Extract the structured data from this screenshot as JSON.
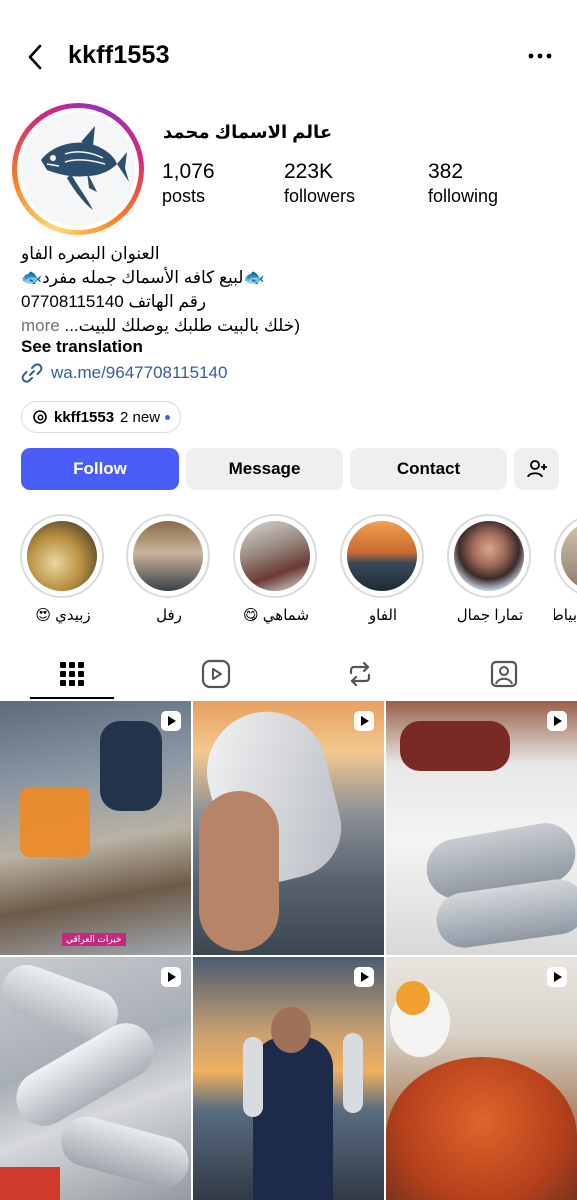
{
  "header": {
    "username": "kkff1553"
  },
  "profile": {
    "display_name": "عالم الاسماك محمد",
    "stats": [
      {
        "value": "1,076",
        "label": "posts"
      },
      {
        "value": "223K",
        "label": "followers"
      },
      {
        "value": "382",
        "label": "following"
      }
    ],
    "bio_lines": [
      "العنوان البصره الفاو",
      "🐟لبيع كافه الأسماك جمله مفرد🐟",
      "رقم الهاتف 07708115140",
      "(خلك بالبيت طلبك يوصلك للبيت..."
    ],
    "more": "more",
    "see_translation": "See translation",
    "link": "wa.me/9647708115140"
  },
  "threads": {
    "username": "kkff1553",
    "new_label": "2 new"
  },
  "buttons": {
    "follow": "Follow",
    "message": "Message",
    "contact": "Contact"
  },
  "highlights": [
    {
      "label": "زبيدي 😍"
    },
    {
      "label": "رفل"
    },
    {
      "label": "شماهي 😋"
    },
    {
      "label": "الفاو"
    },
    {
      "label": "تمارا جمال"
    },
    {
      "label": "بياط"
    }
  ],
  "grid_posts": [
    {
      "type": "reel",
      "overlay_text": "خيرات العراقي"
    },
    {
      "type": "reel"
    },
    {
      "type": "reel"
    },
    {
      "type": "reel"
    },
    {
      "type": "reel"
    },
    {
      "type": "reel"
    }
  ],
  "icons": {
    "back": "chevron-left-icon",
    "more": "more-horizontal-icon",
    "link": "link-icon",
    "threads": "threads-icon",
    "add_user": "add-user-icon",
    "grid": "grid-icon",
    "reels": "reels-icon",
    "reposts": "repost-icon",
    "tagged": "tagged-icon"
  },
  "colors": {
    "accent": "#4a5df9",
    "link": "#365c9e",
    "button_bg": "#efefef",
    "muted": "#737373"
  }
}
